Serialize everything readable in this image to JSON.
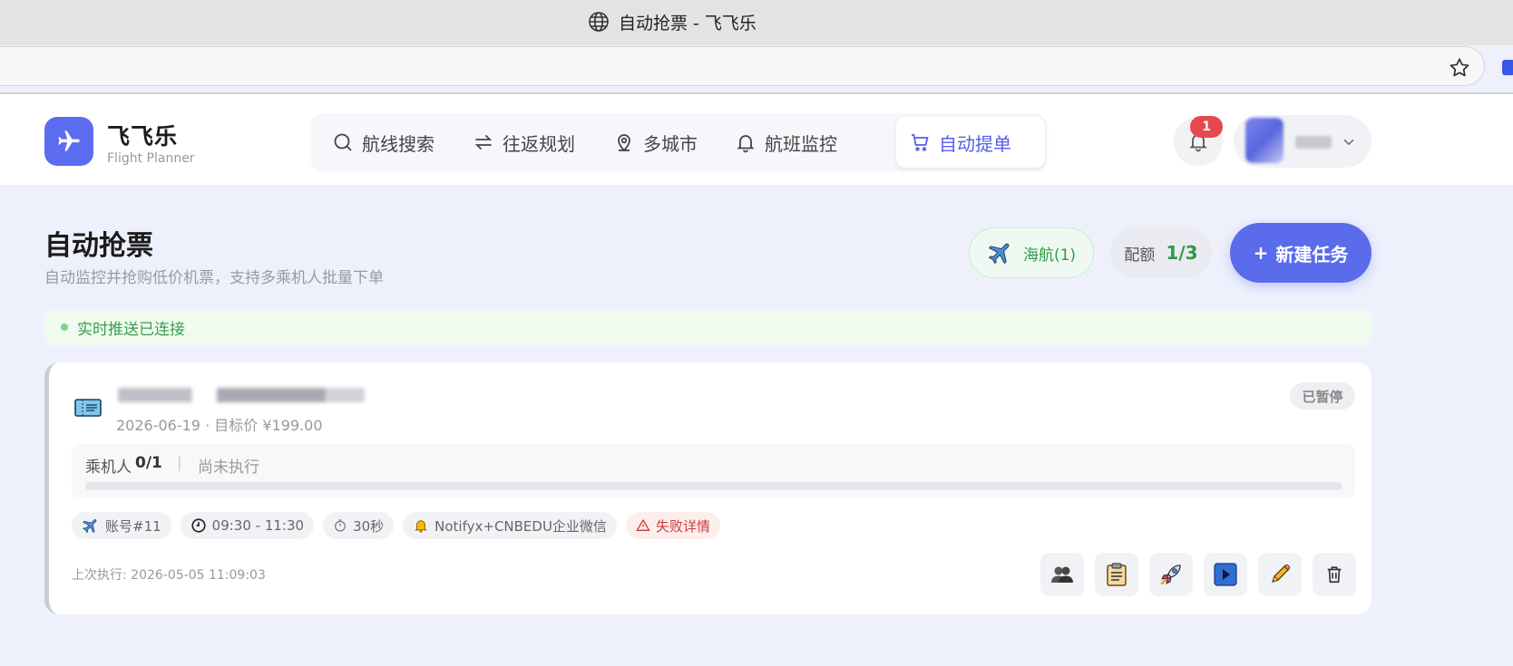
{
  "browser": {
    "tab_title": "自动抢票 - 飞飞乐"
  },
  "app": {
    "brand": "飞飞乐",
    "brand_sub": "Flight Planner"
  },
  "nav": {
    "items": [
      {
        "label": "航线搜索",
        "icon": "search-icon"
      },
      {
        "label": "往返规划",
        "icon": "round-trip-icon"
      },
      {
        "label": "多城市",
        "icon": "map-pin-icon"
      },
      {
        "label": "航班监控",
        "icon": "bell-icon"
      },
      {
        "label": "自动提单",
        "icon": "cart-icon",
        "active": true
      }
    ]
  },
  "user": {
    "notification_count": "1"
  },
  "page": {
    "title": "自动抢票",
    "subtitle": "自动监控并抢购低价机票，支持多乘机人批量下单",
    "airline_chip": "海航(1)",
    "quota_label": "配额",
    "quota_value": "1/3",
    "new_task_label": "新建任务",
    "new_task_icon": "+"
  },
  "status_banner": {
    "text": "实时推送已连接"
  },
  "task": {
    "meta": "2026-06-19 · 目标价 ¥199.00",
    "status": "已暂停",
    "passengers_label": "乘机人",
    "passengers_value": "0/1",
    "separator": "|",
    "exec_status": "尚未执行",
    "progress": 0,
    "chips": {
      "account": "账号#11",
      "time_window": "09:30 - 11:30",
      "interval": "30秒",
      "notify": "Notifyx+CNBEDU企业微信",
      "failure": "失败详情"
    },
    "last_run": "上次执行: 2026-05-05 11:09:03",
    "actions": [
      "passengers-button",
      "orders-button",
      "run-now-button",
      "resume-button",
      "edit-button",
      "delete-button"
    ]
  },
  "colors": {
    "accent": "#5a6cec",
    "success": "#2e9a48",
    "danger": "#e5484d",
    "page_bg": "#eef0fc"
  }
}
